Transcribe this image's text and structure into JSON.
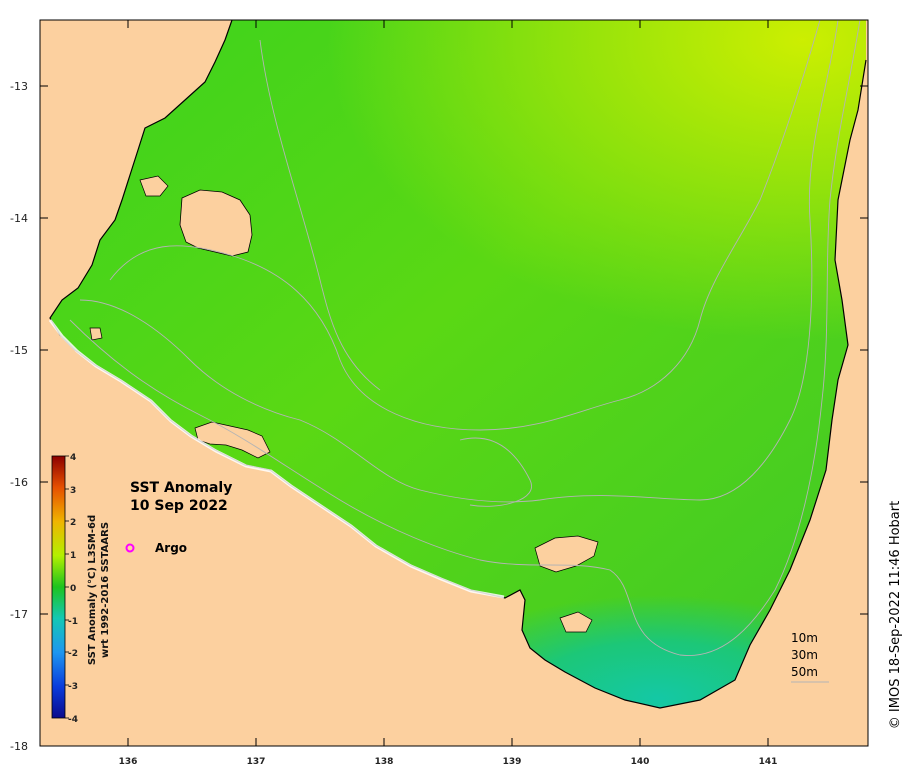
{
  "map": {
    "title_line1": "SST Anomaly",
    "title_line2": "10 Sep 2022",
    "lat_ticks": [
      "-13",
      "-14",
      "-15",
      "-16",
      "-17",
      "-18"
    ],
    "lon_ticks": [
      "136",
      "137",
      "138",
      "139",
      "140",
      "141"
    ],
    "land_color": "#fcd09f",
    "ocean_colors": {
      "main": "#2ec81e",
      "north_east": "#b4f000",
      "south": "#18c38e"
    }
  },
  "legend": {
    "argo_label": "Argo",
    "argo_marker_color": "#ff00ff"
  },
  "colorbar": {
    "label_line1": "SST Anomaly (°C) L3SM-6d",
    "label_line2": "wrt 1992-2016 SSTAARS",
    "ticks": [
      "4",
      "3",
      "2",
      "1",
      "0",
      "-1",
      "-2",
      "-3",
      "-4"
    ]
  },
  "depth_contours": {
    "labels": [
      "10m",
      "30m",
      "50m"
    ]
  },
  "credit": "© IMOS 18-Sep-2022 11:46 Hobart"
}
